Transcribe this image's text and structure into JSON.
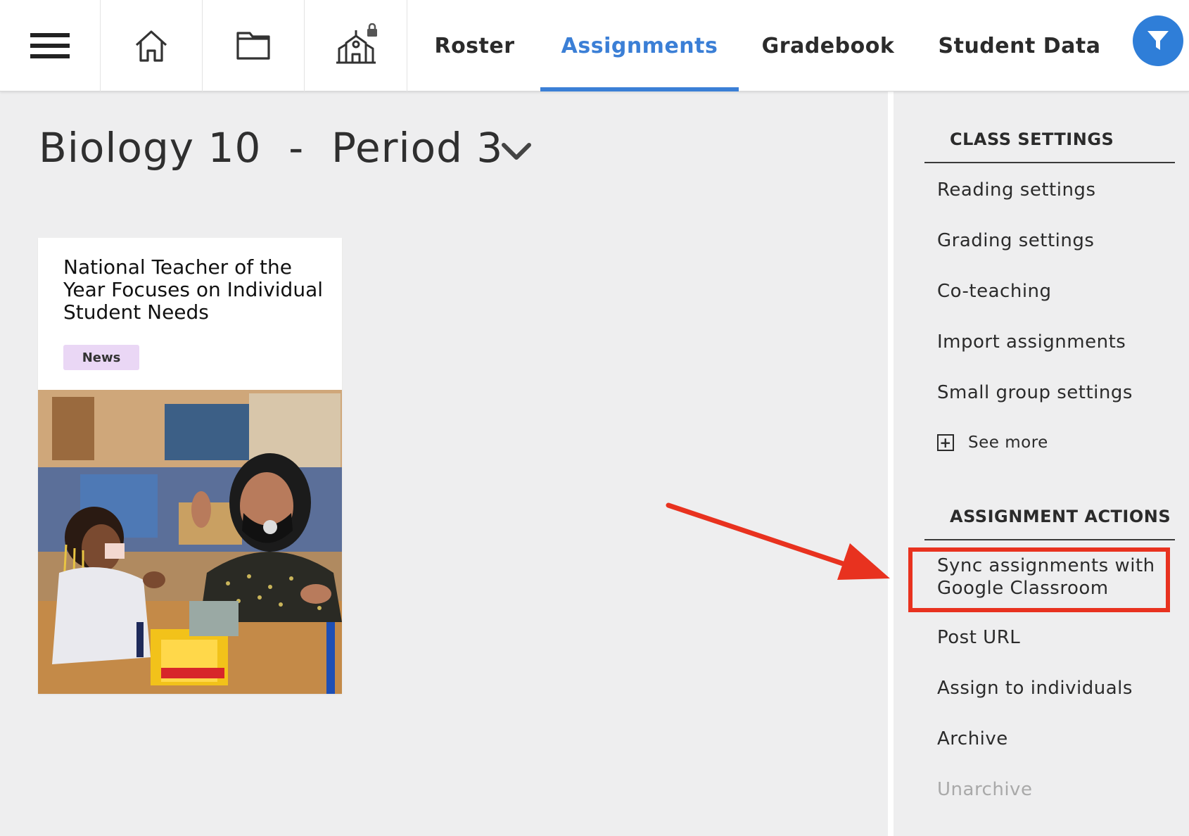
{
  "topbar": {
    "icons": [
      {
        "name": "menu-icon"
      },
      {
        "name": "home-icon"
      },
      {
        "name": "folder-icon"
      },
      {
        "name": "school-locked-icon"
      }
    ],
    "tabs": [
      {
        "label": "Roster",
        "active": false
      },
      {
        "label": "Assignments",
        "active": true
      },
      {
        "label": "Gradebook",
        "active": false
      },
      {
        "label": "Student Data",
        "active": false
      }
    ],
    "filter_icon": "filter-icon",
    "accent_color": "#3b7fd6"
  },
  "main": {
    "class_title": "Biology 10  -  Period 3",
    "card": {
      "title": "National Teacher of the Year Focuses on Individual Student Needs",
      "badge": "News",
      "image_icon": "classroom-photo"
    }
  },
  "sidebar": {
    "class_settings": {
      "heading": "CLASS SETTINGS",
      "items": [
        "Reading settings",
        "Grading settings",
        "Co-teaching",
        "Import assignments",
        "Small group settings"
      ],
      "see_more": "See more"
    },
    "assignment_actions": {
      "heading": "ASSIGNMENT ACTIONS",
      "items": [
        {
          "label": "Sync assignments with Google Classroom",
          "enabled": true,
          "highlighted": true
        },
        {
          "label": "Post URL",
          "enabled": true
        },
        {
          "label": "Assign to individuals",
          "enabled": true
        },
        {
          "label": "Archive",
          "enabled": true
        },
        {
          "label": "Unarchive",
          "enabled": false
        }
      ]
    }
  },
  "annotation": {
    "color": "#e8321f"
  }
}
